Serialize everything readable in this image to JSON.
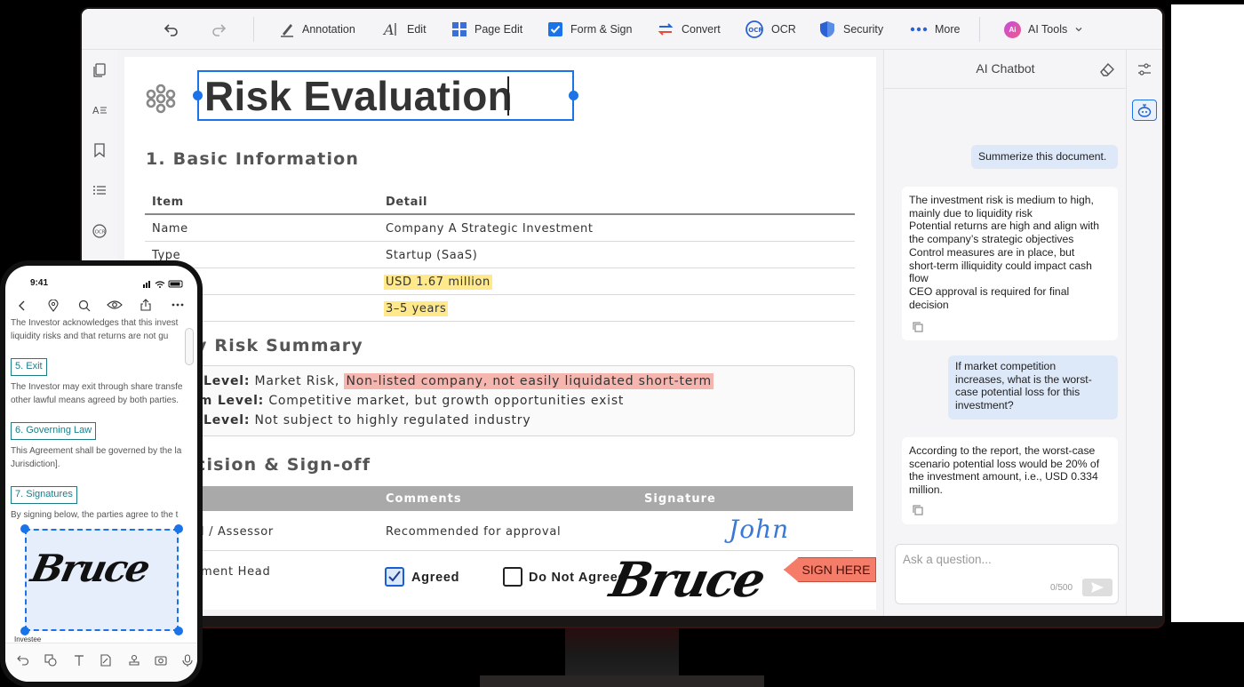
{
  "toolbar": {
    "annotation": "Annotation",
    "edit": "Edit",
    "page_edit": "Page Edit",
    "form_sign": "Form & Sign",
    "convert": "Convert",
    "ocr": "OCR",
    "security": "Security",
    "more": "More",
    "ai_tools": "AI Tools",
    "ai_badge": "Ai"
  },
  "document": {
    "title": "Risk Evaluation",
    "section1": "1. Basic Information",
    "table": {
      "headers": [
        "Item",
        "Detail"
      ],
      "rows": [
        [
          "Name",
          "Company A Strategic Investment"
        ],
        [
          "Type",
          "Startup (SaaS)"
        ],
        [
          "",
          "USD 1.67 million"
        ],
        [
          "",
          "3–5 years"
        ]
      ]
    },
    "section2": "y Risk Summary",
    "risk": {
      "line1_label": "Level:",
      "line1_text": "Market Risk,",
      "line1_highlight": "Non-listed company, not easily liquidated short-term",
      "line2_label": "um Level:",
      "line2_text": "Competitive market, but growth opportunities exist",
      "line3_label": "Level:",
      "line3_text": "Not subject to highly regulated industry"
    },
    "section3": "cision & Sign-off",
    "signoff": {
      "headers": [
        "Comments",
        "Signature"
      ],
      "row1_role": "l / Assessor",
      "row1_comment": "Recommended for approval",
      "row1_signature": "John",
      "row2_role": "ment Head",
      "agreed": "Agreed",
      "not_agreed": "Do Not Agreed",
      "signature": "Bruce"
    },
    "sign_here": "SIGN HERE"
  },
  "chatbot": {
    "title": "AI Chatbot",
    "messages": [
      {
        "role": "user",
        "text": "Summerize this document."
      },
      {
        "role": "bot",
        "lines": [
          "The investment risk is medium to high,",
          "mainly due to liquidity risk",
          "Potential returns are high and align with",
          "the company’s strategic objectives",
          "Control measures are in place, but",
          "short-term illiquidity could impact cash",
          "flow",
          "CEO approval is required for final",
          "decision"
        ]
      },
      {
        "role": "user",
        "lines": [
          "If market competition",
          "increases, what is the worst-",
          "case potential loss for this",
          "investment?"
        ]
      },
      {
        "role": "bot",
        "lines": [
          "According to the report, the worst-case",
          "scenario potential loss would be 20% of",
          "the investment amount, i.e., USD 0.334",
          "million."
        ]
      }
    ],
    "input_placeholder": "Ask a question...",
    "counter": "0/500"
  },
  "phone": {
    "time": "9:41",
    "para1": [
      "The Investor acknowledges that this invest",
      "liquidity risks and that returns are not gu"
    ],
    "exit_tag": "5. Exit",
    "para2": [
      "The Investor may exit through share transfe",
      "other lawful means agreed by both parties."
    ],
    "governing_tag": "6. Governing Law",
    "para3": [
      "This Agreement shall be governed by the la",
      "Jurisdiction]."
    ],
    "signatures_tag": "7. Signatures",
    "para4": "By signing below, the parties agree to the t",
    "signature": "Bruce",
    "investee": "Investee"
  },
  "colors": {
    "accent": "#1a73e8",
    "highlight_yellow": "#ffe98a",
    "highlight_red": "#f6b6b0",
    "sign_here": "#f47c68",
    "phone_tag": "#1c7c88"
  }
}
